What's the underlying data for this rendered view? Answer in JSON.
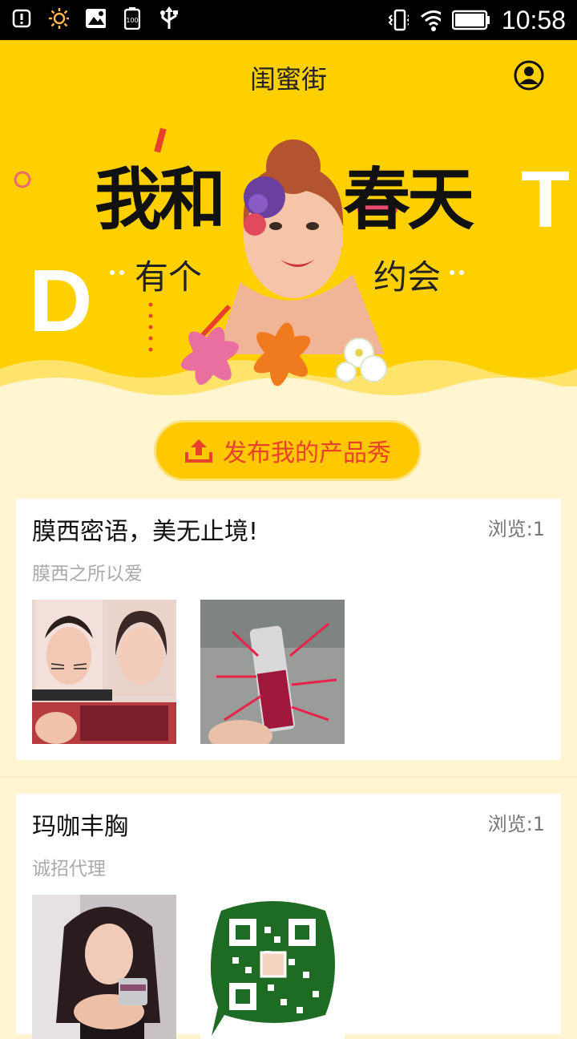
{
  "status_bar": {
    "time": "10:58"
  },
  "header": {
    "title": "闺蜜街"
  },
  "banner": {
    "title_left": "我和",
    "title_right": "春天",
    "subtitle_left": "有个",
    "subtitle_right": "约会",
    "deco_left": "D",
    "deco_right": "T"
  },
  "publish": {
    "label": "发布我的产品秀"
  },
  "posts": [
    {
      "title": "膜西密语，美无止境!",
      "views": "浏览:1",
      "subtitle": "膜西之所以爱"
    },
    {
      "title": "玛咖丰胸",
      "views": "浏览:1",
      "subtitle": "诚招代理"
    }
  ],
  "colors": {
    "accent": "#FFD000",
    "publish_text": "#E8412A",
    "page_bg": "#FFF5D1"
  }
}
